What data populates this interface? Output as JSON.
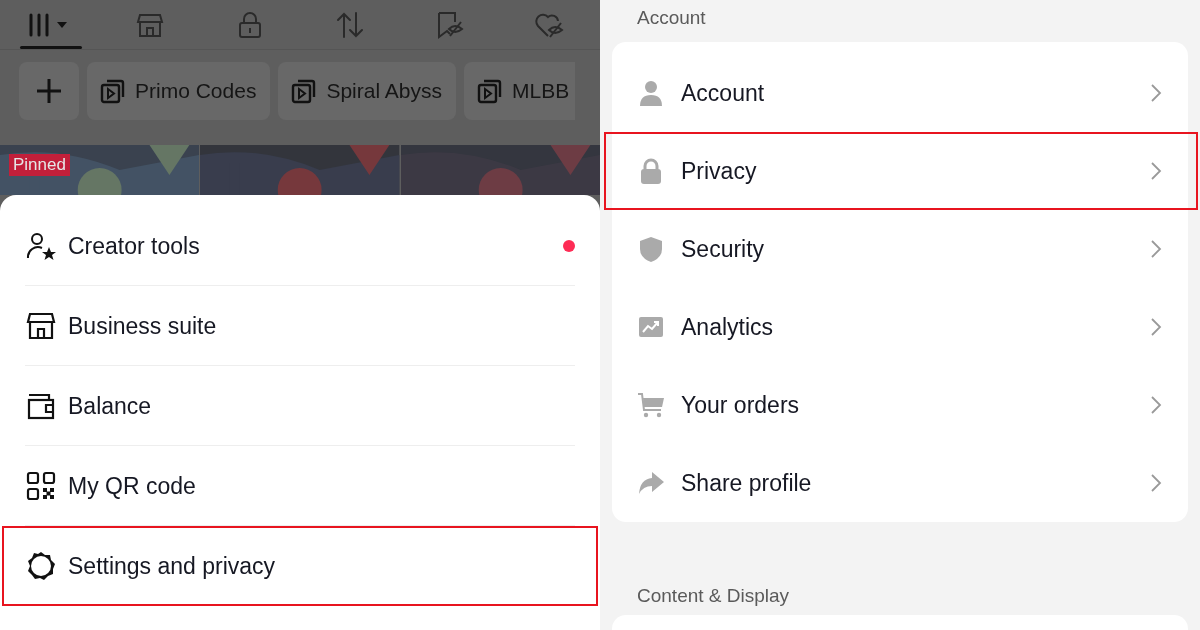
{
  "profile_tabs": [
    {
      "kind": "grid",
      "selected": true
    },
    {
      "kind": "shop",
      "selected": false
    },
    {
      "kind": "lock",
      "selected": false
    },
    {
      "kind": "repost",
      "selected": false
    },
    {
      "kind": "bookmark-hidden",
      "selected": false
    },
    {
      "kind": "heart-hidden",
      "selected": false
    }
  ],
  "playlists": [
    {
      "label": "Primo Codes"
    },
    {
      "label": "Spiral Abyss"
    },
    {
      "label": "MLBB"
    }
  ],
  "videos": [
    {
      "kind": "picture",
      "badge": "Pinned"
    },
    {
      "kind": "picture"
    },
    {
      "kind": "picture"
    }
  ],
  "menu": {
    "items": [
      {
        "kind": "creator",
        "label": "Creator tools",
        "notification": true,
        "highlighted": false
      },
      {
        "kind": "business",
        "label": "Business suite",
        "notification": false,
        "highlighted": false
      },
      {
        "kind": "balance",
        "label": "Balance",
        "notification": false,
        "highlighted": false
      },
      {
        "kind": "qr",
        "label": "My QR code",
        "notification": false,
        "highlighted": false
      },
      {
        "kind": "settings",
        "label": "Settings and privacy",
        "notification": false,
        "highlighted": true
      }
    ]
  },
  "settings": {
    "section": "Account",
    "items": [
      {
        "kind": "account",
        "label": "Account",
        "highlighted": false
      },
      {
        "kind": "privacy",
        "label": "Privacy",
        "highlighted": true
      },
      {
        "kind": "security",
        "label": "Security",
        "highlighted": false
      },
      {
        "kind": "analytics",
        "label": "Analytics",
        "highlighted": false
      },
      {
        "kind": "orders",
        "label": "Your orders",
        "highlighted": false
      },
      {
        "kind": "share",
        "label": "Share profile",
        "highlighted": false
      }
    ],
    "next_section": "Content & Display"
  }
}
